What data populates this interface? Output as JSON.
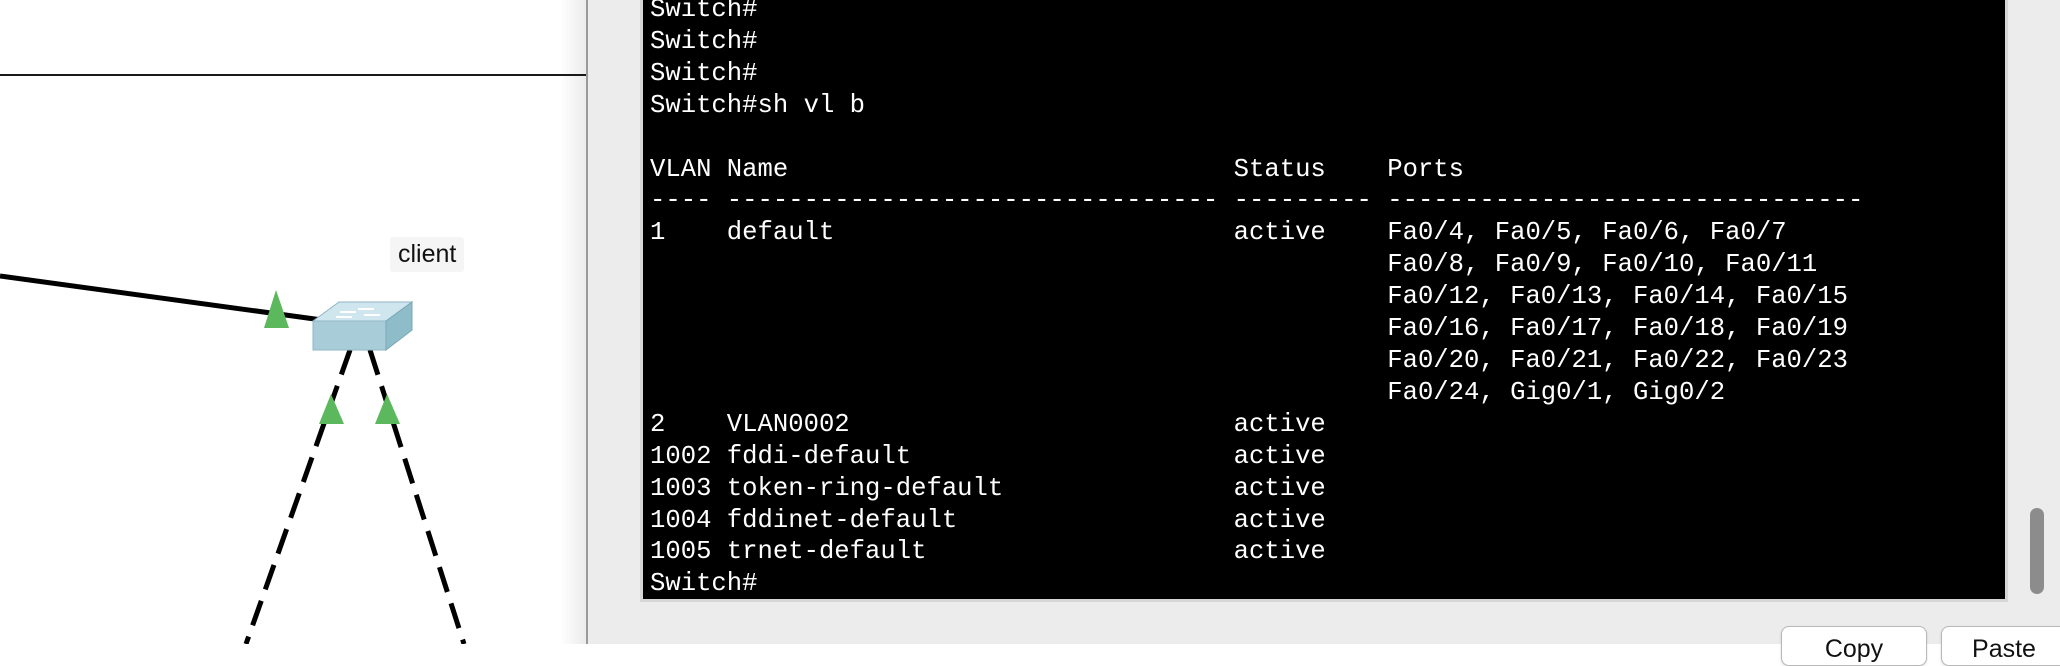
{
  "topology": {
    "device_label": "client",
    "device_icon": "switch-icon",
    "link_up_color": "#5cb85c",
    "switch_color": "#a9cdd8"
  },
  "terminal": {
    "lines": [
      "Switch#",
      "Switch#",
      "Switch#",
      "Switch#sh vl b",
      "",
      "VLAN Name                             Status    Ports",
      "---- -------------------------------- --------- -------------------------------",
      "1    default                          active    Fa0/4, Fa0/5, Fa0/6, Fa0/7",
      "                                                Fa0/8, Fa0/9, Fa0/10, Fa0/11",
      "                                                Fa0/12, Fa0/13, Fa0/14, Fa0/15",
      "                                                Fa0/16, Fa0/17, Fa0/18, Fa0/19",
      "                                                Fa0/20, Fa0/21, Fa0/22, Fa0/23",
      "                                                Fa0/24, Gig0/1, Gig0/2",
      "2    VLAN0002                         active",
      "1002 fddi-default                     active",
      "1003 token-ring-default               active",
      "1004 fddinet-default                  active",
      "1005 trnet-default                    active",
      "Switch#"
    ]
  },
  "buttons": {
    "copy_label": "Copy",
    "paste_label": "Paste"
  }
}
